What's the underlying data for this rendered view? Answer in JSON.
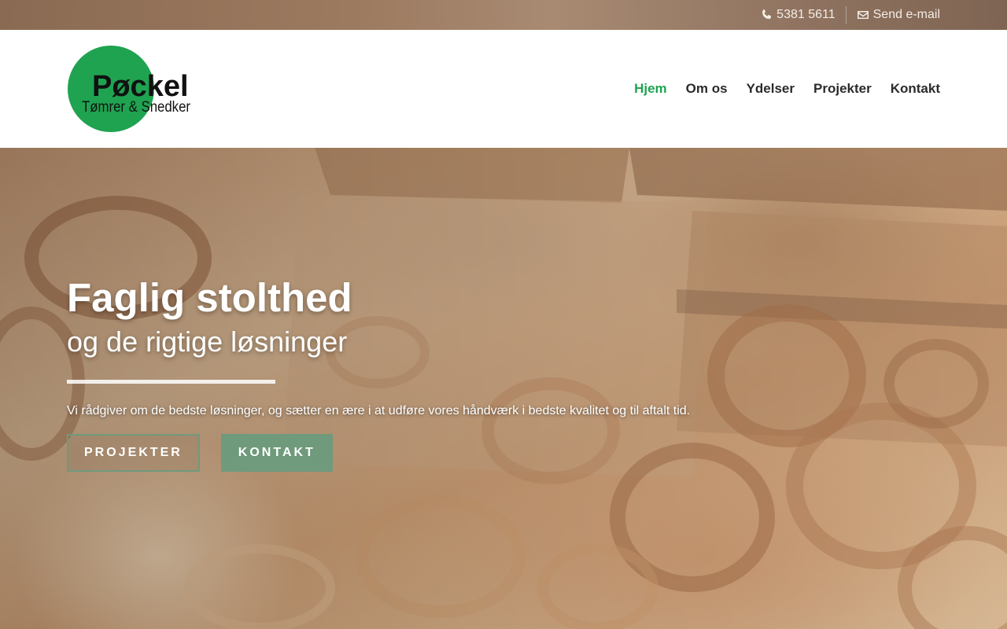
{
  "topbar": {
    "phone": "5381 5611",
    "email": "Send e-mail",
    "icons": [
      "phone-icon",
      "envelope-icon"
    ]
  },
  "logo": {
    "name": "Pøckel",
    "tagline": "Tømrer & Snedker",
    "circle_color": "#1fa351"
  },
  "nav": {
    "items": [
      {
        "label": "Hjem",
        "active": true
      },
      {
        "label": "Om os"
      },
      {
        "label": "Ydelser"
      },
      {
        "label": "Projekter"
      },
      {
        "label": "Kontakt"
      }
    ],
    "active_color": "#1fa351"
  },
  "hero": {
    "title": "Faglig stolthed",
    "subtitle": "og de rigtige løsninger",
    "text": "Vi rådgiver om de bedste løsninger, og sætter en ære i at udføre vores håndværk i bedste kvalitet og til aftalt tid.",
    "buttons": {
      "projects": "PROJEKTER",
      "contact": "KONTAKT"
    },
    "button_color": "#6f9a7c"
  }
}
